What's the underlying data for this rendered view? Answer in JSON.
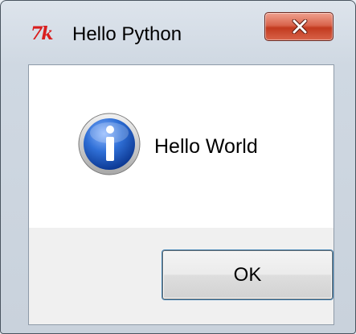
{
  "window": {
    "title": "Hello Python",
    "app_icon": "tk-feather-logo",
    "app_icon_text": "7k",
    "controls": {
      "close_icon": "close-icon"
    }
  },
  "dialog": {
    "icon": "info-icon",
    "message": "Hello World",
    "buttons": {
      "ok_label": "OK"
    }
  },
  "colors": {
    "close_button": "#c8452b",
    "tk_logo": "#d91e1e",
    "info_icon": "#1f5bbf"
  }
}
